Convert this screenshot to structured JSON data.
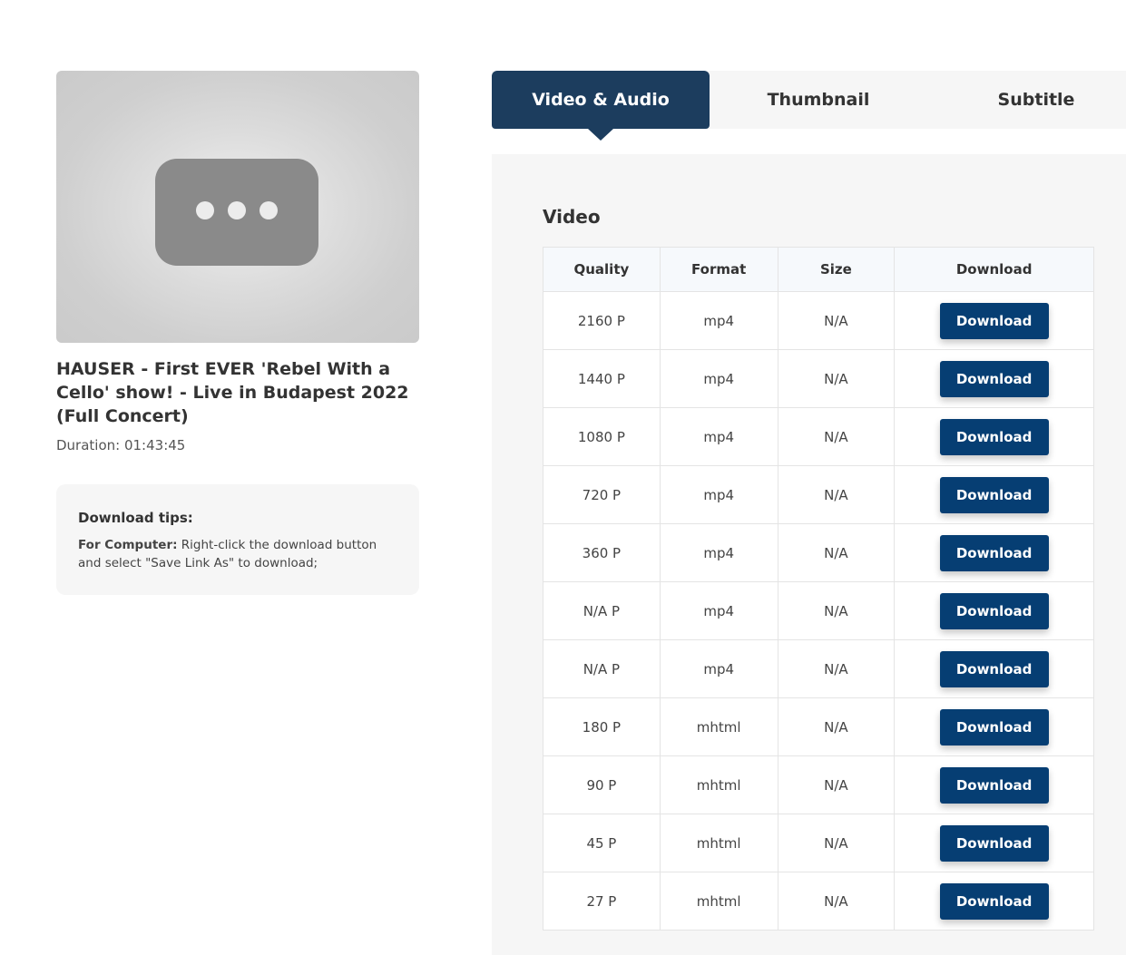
{
  "video": {
    "title": "HAUSER - First EVER 'Rebel With a Cello' show! - Live in Budapest 2022 (Full Concert)",
    "duration": "Duration: 01:43:45"
  },
  "tips": {
    "heading": "Download tips:",
    "label": "For Computer:",
    "text": " Right-click the download button and select \"Save Link As\" to download;"
  },
  "tabs": [
    {
      "label": "Video & Audio",
      "active": true
    },
    {
      "label": "Thumbnail",
      "active": false
    },
    {
      "label": "Subtitle",
      "active": false
    }
  ],
  "section": {
    "title": "Video"
  },
  "table": {
    "headers": [
      "Quality",
      "Format",
      "Size",
      "Download"
    ],
    "rows": [
      {
        "quality": "2160 P",
        "format": "mp4",
        "size": "N/A",
        "button": "Download"
      },
      {
        "quality": "1440 P",
        "format": "mp4",
        "size": "N/A",
        "button": "Download"
      },
      {
        "quality": "1080 P",
        "format": "mp4",
        "size": "N/A",
        "button": "Download"
      },
      {
        "quality": "720 P",
        "format": "mp4",
        "size": "N/A",
        "button": "Download"
      },
      {
        "quality": "360 P",
        "format": "mp4",
        "size": "N/A",
        "button": "Download"
      },
      {
        "quality": "N/A P",
        "format": "mp4",
        "size": "N/A",
        "button": "Download"
      },
      {
        "quality": "N/A P",
        "format": "mp4",
        "size": "N/A",
        "button": "Download"
      },
      {
        "quality": "180 P",
        "format": "mhtml",
        "size": "N/A",
        "button": "Download"
      },
      {
        "quality": "90 P",
        "format": "mhtml",
        "size": "N/A",
        "button": "Download"
      },
      {
        "quality": "45 P",
        "format": "mhtml",
        "size": "N/A",
        "button": "Download"
      },
      {
        "quality": "27 P",
        "format": "mhtml",
        "size": "N/A",
        "button": "Download"
      }
    ]
  },
  "colors": {
    "primary": "#1c3d5e",
    "button": "#063e73",
    "panel": "#f6f6f6"
  },
  "icons": {
    "thumbnail_placeholder": "video-loading-icon"
  }
}
